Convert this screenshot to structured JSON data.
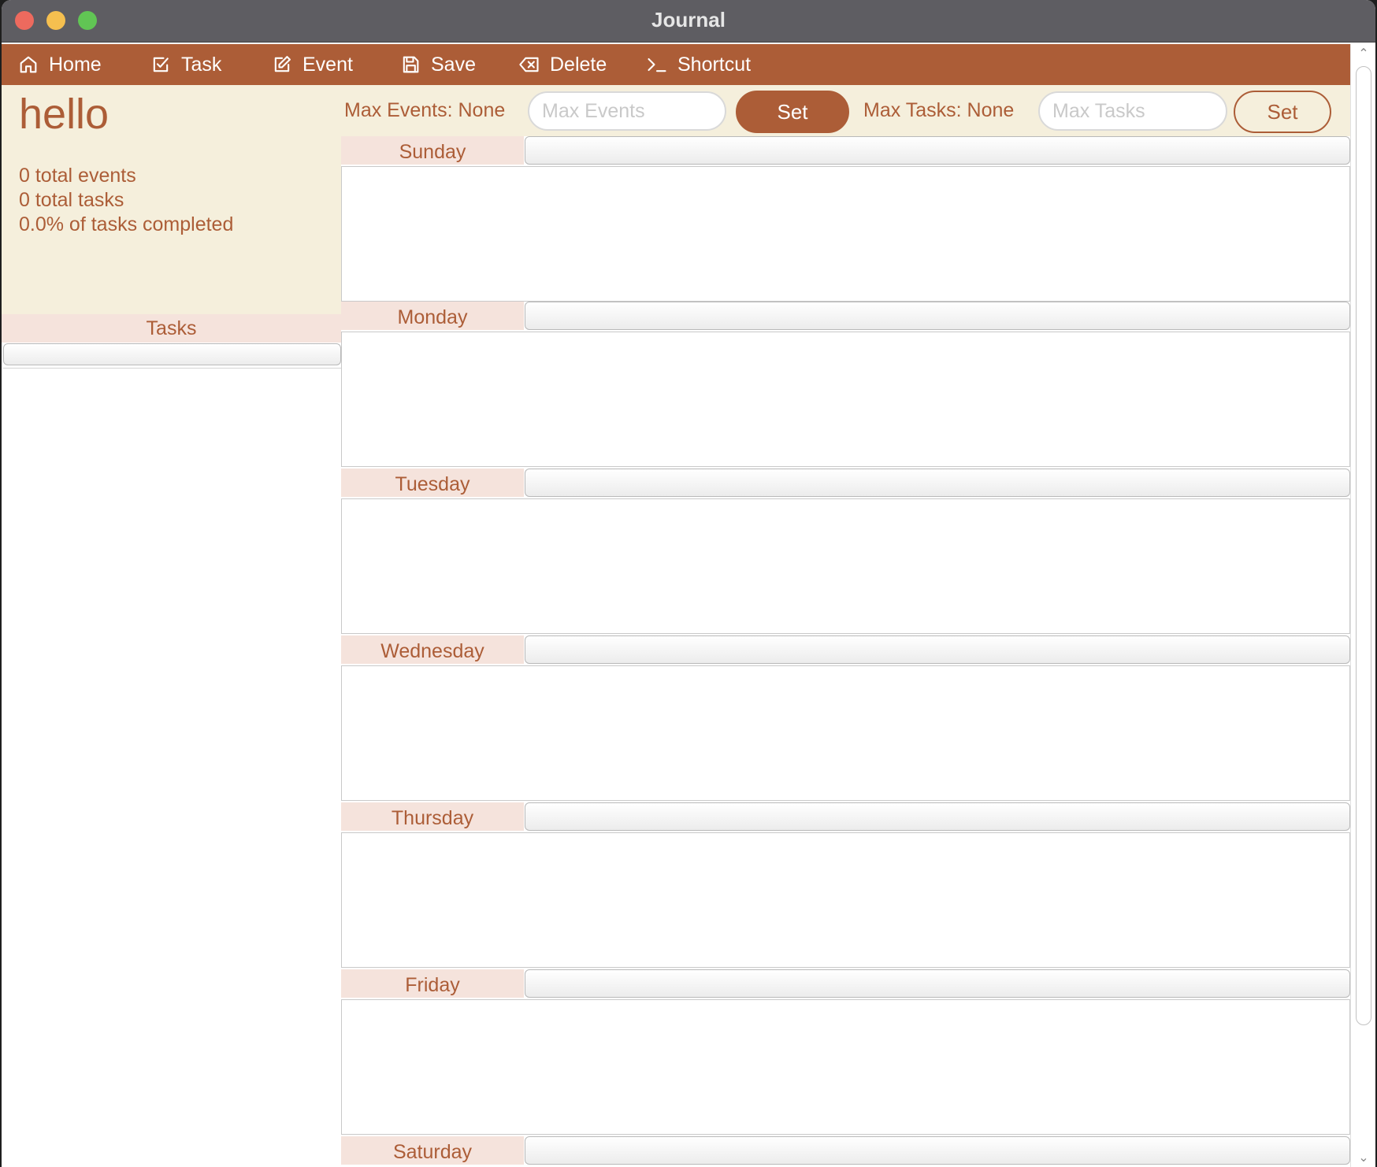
{
  "window": {
    "title": "Journal"
  },
  "menu": {
    "home": "Home",
    "task": "Task",
    "event": "Event",
    "save": "Save",
    "delete": "Delete",
    "shortcut": "Shortcut"
  },
  "summary": {
    "journal_name": "hello",
    "total_events": "0 total events",
    "total_tasks": "0 total tasks",
    "completion": "0.0% of tasks completed"
  },
  "tasks_panel": {
    "header": "Tasks",
    "items": []
  },
  "controls": {
    "max_events_label": "Max Events: None",
    "max_events_placeholder": "Max Events",
    "max_events_value": "",
    "set_events_label": "Set",
    "max_tasks_label": "Max Tasks: None",
    "max_tasks_placeholder": "Max Tasks",
    "max_tasks_value": "",
    "set_tasks_label": "Set"
  },
  "week": {
    "days": [
      {
        "name": "Sunday",
        "events": []
      },
      {
        "name": "Monday",
        "events": []
      },
      {
        "name": "Tuesday",
        "events": []
      },
      {
        "name": "Wednesday",
        "events": []
      },
      {
        "name": "Thursday",
        "events": []
      },
      {
        "name": "Friday",
        "events": []
      },
      {
        "name": "Saturday",
        "events": []
      }
    ]
  },
  "theme": {
    "accent": "#ac5d37",
    "summary_bg": "#f5efdc",
    "header_bg": "#f5e3dc"
  },
  "icons": {
    "home": "home-icon",
    "task": "checkbox-icon",
    "event": "edit-icon",
    "save": "floppy-icon",
    "delete": "backspace-icon",
    "shortcut": "terminal-icon"
  }
}
